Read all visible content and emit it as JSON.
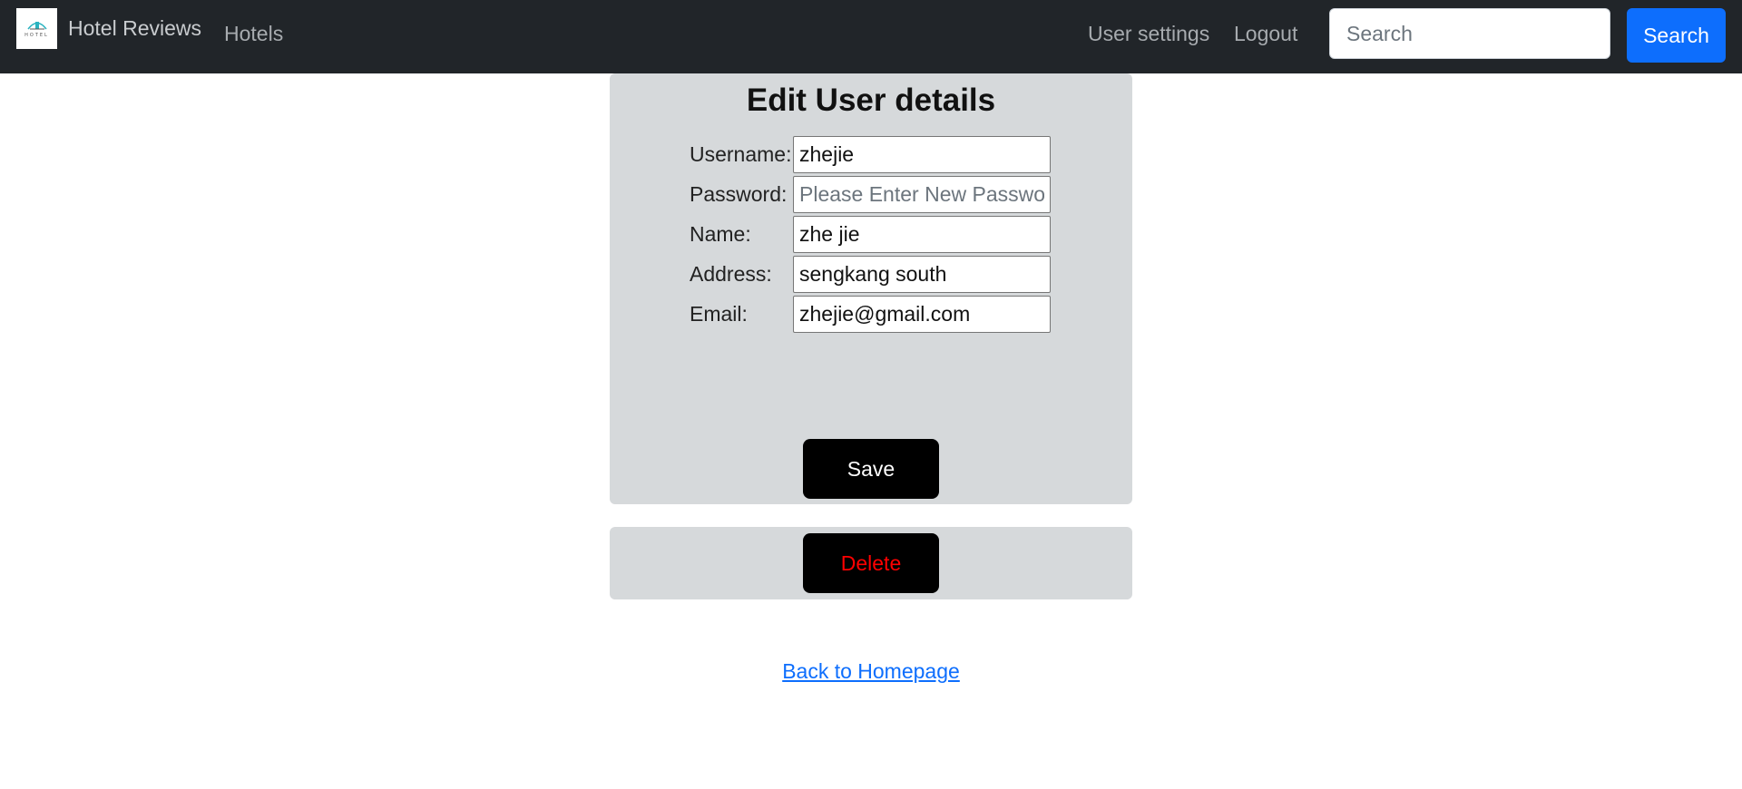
{
  "navbar": {
    "logo_text": "HOTEL",
    "brand": "Hotel Reviews",
    "hotels_link": "Hotels",
    "user_settings_link": "User settings",
    "logout_link": "Logout",
    "search_placeholder": "Search",
    "search_button": "Search"
  },
  "edit_form": {
    "title": "Edit User details",
    "fields": [
      {
        "label": "Username:",
        "value": "zhejie",
        "placeholder": ""
      },
      {
        "label": "Password:",
        "value": "",
        "placeholder": "Please Enter New Password"
      },
      {
        "label": "Name:",
        "value": "zhe jie",
        "placeholder": ""
      },
      {
        "label": "Address:",
        "value": "sengkang south",
        "placeholder": ""
      },
      {
        "label": "Email:",
        "value": "zhejie@gmail.com",
        "placeholder": ""
      }
    ],
    "save_button": "Save"
  },
  "delete_section": {
    "delete_button": "Delete"
  },
  "footer": {
    "back_link": "Back to Homepage"
  },
  "colors": {
    "navbar_bg": "#212529",
    "card_bg": "#d6d9db",
    "primary": "#0d6efd",
    "delete_text": "#ff0000"
  }
}
